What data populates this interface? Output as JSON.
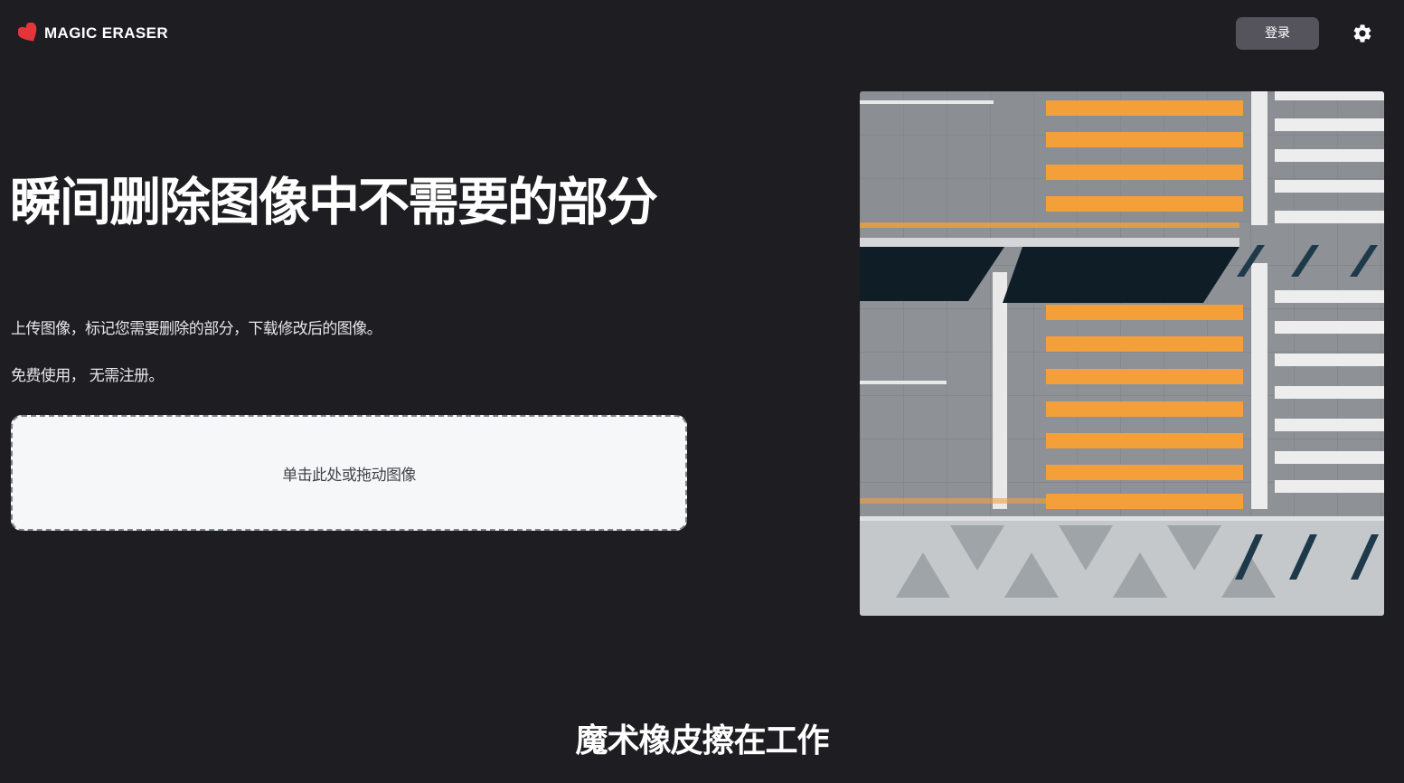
{
  "header": {
    "logo_text": "MAGIC ERASER",
    "logo_icon": "heart-icon",
    "login_label": "登录",
    "settings_icon": "gear-icon"
  },
  "hero": {
    "title": "瞬间删除图像中不需要的部分",
    "description": "上传图像，标记您需要删除的部分，下载修改后的图像。",
    "free_note": "免费使用， 无需注册。",
    "dropzone_label": "单击此处或拖动图像",
    "image_subject": "aerial view of a pedestrian crosswalk"
  },
  "section": {
    "title": "魔术橡皮擦在工作"
  },
  "colors": {
    "background": "#1e1d22",
    "logo_red": "#e6343b",
    "button_bg": "#55545c",
    "dropzone_bg": "#f6f7f9",
    "crosswalk_orange": "#f3a03a"
  }
}
